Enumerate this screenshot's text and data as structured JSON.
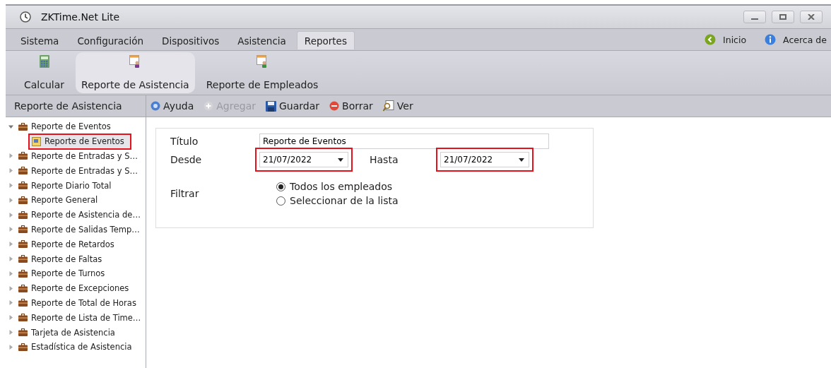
{
  "window": {
    "title": "ZKTime.Net Lite"
  },
  "menu": {
    "tabs": [
      {
        "label": "Sistema",
        "selected": false
      },
      {
        "label": "Configuración",
        "selected": false
      },
      {
        "label": "Dispositivos",
        "selected": false
      },
      {
        "label": "Asistencia",
        "selected": false
      },
      {
        "label": "Reportes",
        "selected": true
      }
    ],
    "links": [
      {
        "label": "Inicio",
        "kind": "home"
      },
      {
        "label": "Acerca de",
        "kind": "info"
      }
    ]
  },
  "ribbon": [
    {
      "label": "Calcular",
      "kind": "calc",
      "selected": false
    },
    {
      "label": "Reporte de Asistencia",
      "kind": "report",
      "selected": true
    },
    {
      "label": "Reporte de Empleados",
      "kind": "employee",
      "selected": false
    }
  ],
  "sidebar": {
    "title": "Reporte de Asistencia",
    "items": [
      {
        "label": "Reporte de Eventos",
        "expanded": true,
        "children": [
          {
            "label": "Reporte de Eventos",
            "selected": true,
            "highlighted": true
          }
        ]
      },
      {
        "label": "Reporte de Entradas y S…",
        "expanded": false
      },
      {
        "label": "Reporte de Entradas y S…",
        "expanded": false
      },
      {
        "label": "Reporte Diario Total",
        "expanded": false
      },
      {
        "label": "Reporte General",
        "expanded": false
      },
      {
        "label": "Reporte de Asistencia de…",
        "expanded": false
      },
      {
        "label": "Reporte de Salidas Temp…",
        "expanded": false
      },
      {
        "label": "Reporte de Retardos",
        "expanded": false
      },
      {
        "label": "Reporte de Faltas",
        "expanded": false
      },
      {
        "label": "Reporte de Turnos",
        "expanded": false
      },
      {
        "label": "Reporte de Excepciones",
        "expanded": false
      },
      {
        "label": "Reporte de Total de Horas",
        "expanded": false
      },
      {
        "label": "Reporte de Lista de Time…",
        "expanded": false
      },
      {
        "label": "Tarjeta de Asistencia",
        "expanded": false
      },
      {
        "label": "Estadística de Asistencia",
        "expanded": false
      }
    ]
  },
  "toolbar": [
    {
      "label": "Ayuda",
      "kind": "help",
      "disabled": false
    },
    {
      "label": "Agregar",
      "kind": "add",
      "disabled": true
    },
    {
      "label": "Guardar",
      "kind": "save",
      "disabled": false
    },
    {
      "label": "Borrar",
      "kind": "delete",
      "disabled": false
    },
    {
      "label": "Ver",
      "kind": "view",
      "disabled": false
    }
  ],
  "form": {
    "title_label": "Título",
    "title_value": "Reporte de Eventos",
    "from_label": "Desde",
    "from_value": "21/07/2022",
    "from_highlighted": true,
    "to_label": "Hasta",
    "to_value": "21/07/2022",
    "to_highlighted": true,
    "filter_label": "Filtrar",
    "options": [
      {
        "label": "Todos los empleados",
        "selected": true
      },
      {
        "label": "Seleccionar de la lista",
        "selected": false
      }
    ]
  }
}
